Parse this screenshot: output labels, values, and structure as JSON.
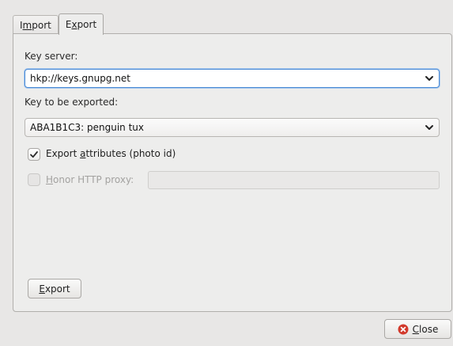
{
  "tabs": [
    {
      "pre": "I",
      "u": "m",
      "post": "port"
    },
    {
      "pre": "E",
      "u": "x",
      "post": "port"
    }
  ],
  "key_server": {
    "label": "Key server:",
    "value": "hkp://keys.gnupg.net"
  },
  "key_export": {
    "label": "Key to be exported:",
    "value": "ABA1B1C3: penguin tux"
  },
  "export_attributes": {
    "pre": "Export ",
    "u": "a",
    "post": "ttributes (photo id)",
    "checked": true
  },
  "honor_proxy": {
    "pre": "",
    "u": "H",
    "post": "onor HTTP proxy:",
    "checked": false,
    "value": ""
  },
  "export_button": {
    "pre": "",
    "u": "E",
    "post": "xport"
  },
  "close_button": {
    "pre": "",
    "u": "C",
    "post": "lose"
  },
  "colors": {
    "focus": "#4a8ad4",
    "close_icon": "#d23a2c"
  }
}
